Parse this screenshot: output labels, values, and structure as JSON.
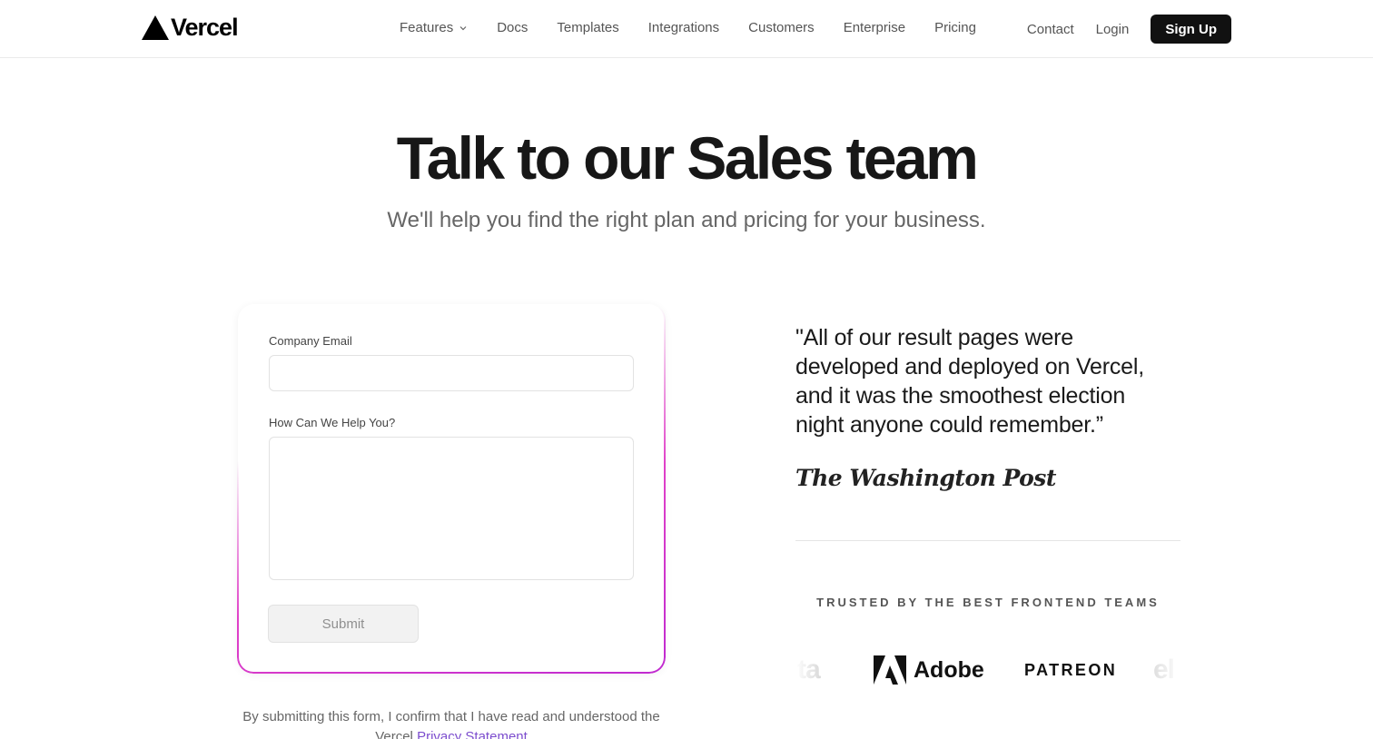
{
  "header": {
    "brand": "Vercel",
    "nav": [
      {
        "label": "Features",
        "has_dropdown": true
      },
      {
        "label": "Docs"
      },
      {
        "label": "Templates"
      },
      {
        "label": "Integrations"
      },
      {
        "label": "Customers"
      },
      {
        "label": "Enterprise"
      },
      {
        "label": "Pricing"
      }
    ],
    "contact_label": "Contact",
    "login_label": "Login",
    "signup_label": "Sign Up"
  },
  "hero": {
    "title": "Talk to our Sales team",
    "subtitle": "We'll help you find the right plan and pricing for your business."
  },
  "form": {
    "email_label": "Company Email",
    "email_value": "",
    "help_label": "How Can We Help You?",
    "help_value": "",
    "submit_label": "Submit",
    "consent_text": "By submitting this form, I confirm that I have read and understood the Vercel",
    "consent_link": "Privacy Statement",
    "accent_gradient": [
      "#e040c8",
      "#c02ad0"
    ]
  },
  "testimonial": {
    "quote": "\"All of our result pages were developed and deployed on Vercel, and it was the smoothest election night anyone could remember.”",
    "source": "The Washington Post"
  },
  "trusted": {
    "heading": "TRUSTED BY THE BEST FRONTEND TEAMS",
    "logos": [
      "ta",
      "Adobe",
      "PATREON",
      "el"
    ]
  },
  "colors": {
    "primary_button_bg": "#111111",
    "link": "#7c4dce",
    "muted_text": "#666666"
  }
}
